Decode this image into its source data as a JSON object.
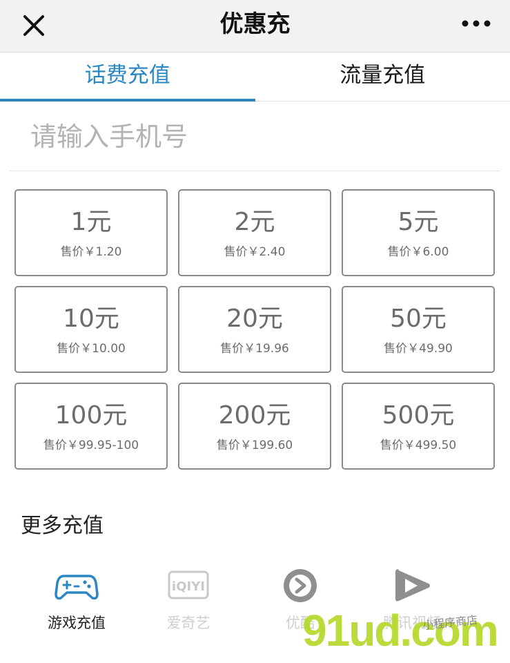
{
  "navbar": {
    "title": "优惠充"
  },
  "tabs": [
    {
      "label": "话费充值",
      "active": true
    },
    {
      "label": "流量充值",
      "active": false
    }
  ],
  "phone": {
    "placeholder": "请输入手机号",
    "value": ""
  },
  "options": [
    {
      "amount": "1元",
      "price": "售价￥1.20"
    },
    {
      "amount": "2元",
      "price": "售价￥2.40"
    },
    {
      "amount": "5元",
      "price": "售价￥6.00"
    },
    {
      "amount": "10元",
      "price": "售价￥10.00"
    },
    {
      "amount": "20元",
      "price": "售价￥19.96"
    },
    {
      "amount": "50元",
      "price": "售价￥49.90"
    },
    {
      "amount": "100元",
      "price": "售价￥99.95-100"
    },
    {
      "amount": "200元",
      "price": "售价￥199.60"
    },
    {
      "amount": "500元",
      "price": "售价￥499.50"
    }
  ],
  "more": {
    "title": "更多充值",
    "items": [
      {
        "label": "游戏充值",
        "icon": "gamepad-icon",
        "color": "#2a87c3"
      },
      {
        "label": "爱奇艺",
        "icon": "iqiyi-icon",
        "color": "#c8c8c8"
      },
      {
        "label": "优酷",
        "icon": "youku-icon",
        "color": "#8f8f8f"
      },
      {
        "label": "腾讯视频",
        "icon": "tencent-video-icon",
        "color": "#8f8f8f"
      }
    ]
  },
  "watermark": {
    "text": "91ud.com",
    "sub": "小程序商店"
  },
  "colors": {
    "accent": "#2a87c3",
    "border": "#8a8a8a",
    "muted": "#6b6b6b"
  }
}
